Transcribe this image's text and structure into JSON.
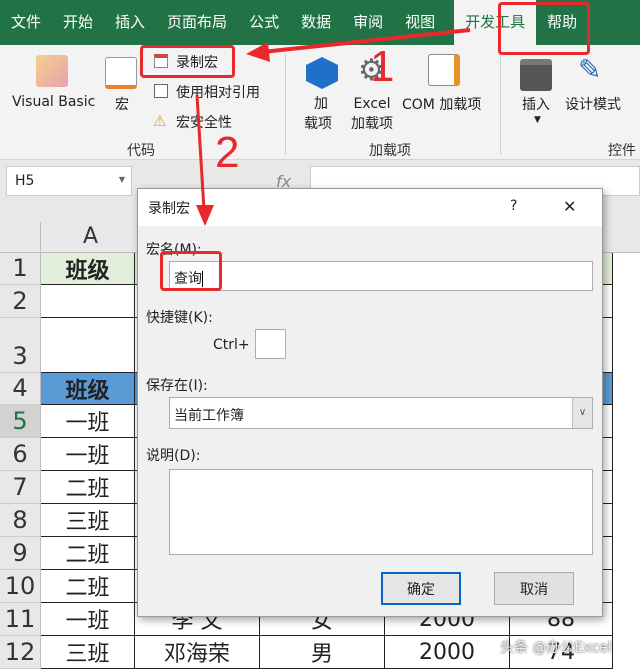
{
  "tabs": [
    "文件",
    "开始",
    "插入",
    "页面布局",
    "公式",
    "数据",
    "审阅",
    "视图",
    "开发工具",
    "帮助"
  ],
  "ribbon": {
    "code_group": {
      "label": "代码",
      "visual_basic": "Visual Basic",
      "macros": "宏",
      "record_macro": "录制宏",
      "relative_ref": "使用相对引用",
      "macro_security": "宏安全性"
    },
    "addins_group": {
      "label": "加载项",
      "addins": "加\n载项",
      "addins_l1": "加",
      "addins_l2": "载项",
      "excel_addins_l1": "Excel",
      "excel_addins_l2": "加载项",
      "com_addins": "COM 加载项"
    },
    "controls_group": {
      "label": "控件",
      "insert": "插入",
      "design_mode": "设计模式"
    }
  },
  "name_box": "H5",
  "formula_fx": "fx",
  "column_header": "A",
  "rows": [
    {
      "n": "1",
      "a": "班级"
    },
    {
      "n": "2",
      "a": ""
    },
    {
      "n": "3",
      "a": ""
    },
    {
      "n": "4",
      "a": "班级"
    },
    {
      "n": "5",
      "a": "一班"
    },
    {
      "n": "6",
      "a": "一班"
    },
    {
      "n": "7",
      "a": "二班"
    },
    {
      "n": "8",
      "a": "三班"
    },
    {
      "n": "9",
      "a": "二班"
    },
    {
      "n": "10",
      "a": "二班"
    },
    {
      "n": "11",
      "a": "一班",
      "b": "李 文",
      "c": "女",
      "d": "2000",
      "e": "88"
    },
    {
      "n": "12",
      "a": "三班",
      "b": "邓海荣",
      "c": "男",
      "d": "2000",
      "e": "74"
    }
  ],
  "dialog": {
    "title": "录制宏",
    "help": "?",
    "close": "✕",
    "macro_name_label": "宏名(M):",
    "macro_name_value": "查询",
    "shortcut_label": "快捷键(K):",
    "ctrl_label": "Ctrl+",
    "shortcut_value": "",
    "store_label": "保存在(I):",
    "store_value": "当前工作簿",
    "desc_label": "说明(D):",
    "desc_value": "",
    "ok": "确定",
    "cancel": "取消"
  },
  "annotations": {
    "step1": "1",
    "step2": "2"
  },
  "watermark": "头条 @办公Excel",
  "colors": {
    "excel_green": "#217346",
    "annotation_red": "#e8282b",
    "header_blue": "#5b9bd5",
    "header_green": "#e2efda"
  }
}
